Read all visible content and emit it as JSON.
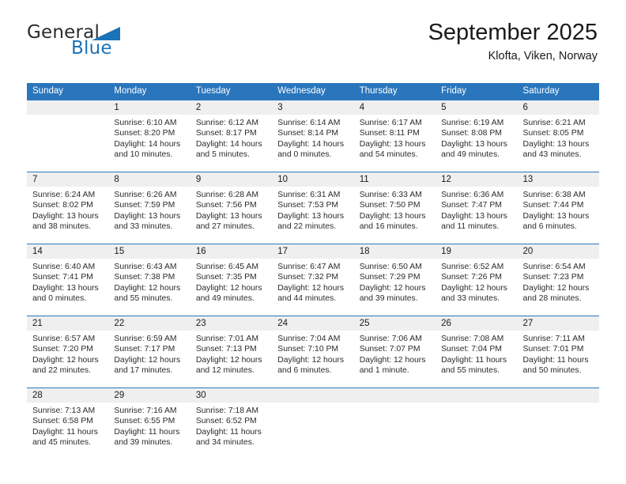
{
  "brand": {
    "name_part1": "General",
    "name_part2": "Blue",
    "triangle_icon": "triangle-icon",
    "accent_color": "#1b72b8"
  },
  "header": {
    "title": "September 2025",
    "subtitle": "Klofta, Viken, Norway"
  },
  "calendar": {
    "header_color": "#2a76bd",
    "daynum_band_color": "#efefef",
    "weekday_headers": [
      "Sunday",
      "Monday",
      "Tuesday",
      "Wednesday",
      "Thursday",
      "Friday",
      "Saturday"
    ],
    "weeks": [
      [
        {
          "day": "",
          "sunrise": "",
          "sunset": "",
          "daylight": ""
        },
        {
          "day": "1",
          "sunrise": "Sunrise: 6:10 AM",
          "sunset": "Sunset: 8:20 PM",
          "daylight": "Daylight: 14 hours and 10 minutes."
        },
        {
          "day": "2",
          "sunrise": "Sunrise: 6:12 AM",
          "sunset": "Sunset: 8:17 PM",
          "daylight": "Daylight: 14 hours and 5 minutes."
        },
        {
          "day": "3",
          "sunrise": "Sunrise: 6:14 AM",
          "sunset": "Sunset: 8:14 PM",
          "daylight": "Daylight: 14 hours and 0 minutes."
        },
        {
          "day": "4",
          "sunrise": "Sunrise: 6:17 AM",
          "sunset": "Sunset: 8:11 PM",
          "daylight": "Daylight: 13 hours and 54 minutes."
        },
        {
          "day": "5",
          "sunrise": "Sunrise: 6:19 AM",
          "sunset": "Sunset: 8:08 PM",
          "daylight": "Daylight: 13 hours and 49 minutes."
        },
        {
          "day": "6",
          "sunrise": "Sunrise: 6:21 AM",
          "sunset": "Sunset: 8:05 PM",
          "daylight": "Daylight: 13 hours and 43 minutes."
        }
      ],
      [
        {
          "day": "7",
          "sunrise": "Sunrise: 6:24 AM",
          "sunset": "Sunset: 8:02 PM",
          "daylight": "Daylight: 13 hours and 38 minutes."
        },
        {
          "day": "8",
          "sunrise": "Sunrise: 6:26 AM",
          "sunset": "Sunset: 7:59 PM",
          "daylight": "Daylight: 13 hours and 33 minutes."
        },
        {
          "day": "9",
          "sunrise": "Sunrise: 6:28 AM",
          "sunset": "Sunset: 7:56 PM",
          "daylight": "Daylight: 13 hours and 27 minutes."
        },
        {
          "day": "10",
          "sunrise": "Sunrise: 6:31 AM",
          "sunset": "Sunset: 7:53 PM",
          "daylight": "Daylight: 13 hours and 22 minutes."
        },
        {
          "day": "11",
          "sunrise": "Sunrise: 6:33 AM",
          "sunset": "Sunset: 7:50 PM",
          "daylight": "Daylight: 13 hours and 16 minutes."
        },
        {
          "day": "12",
          "sunrise": "Sunrise: 6:36 AM",
          "sunset": "Sunset: 7:47 PM",
          "daylight": "Daylight: 13 hours and 11 minutes."
        },
        {
          "day": "13",
          "sunrise": "Sunrise: 6:38 AM",
          "sunset": "Sunset: 7:44 PM",
          "daylight": "Daylight: 13 hours and 6 minutes."
        }
      ],
      [
        {
          "day": "14",
          "sunrise": "Sunrise: 6:40 AM",
          "sunset": "Sunset: 7:41 PM",
          "daylight": "Daylight: 13 hours and 0 minutes."
        },
        {
          "day": "15",
          "sunrise": "Sunrise: 6:43 AM",
          "sunset": "Sunset: 7:38 PM",
          "daylight": "Daylight: 12 hours and 55 minutes."
        },
        {
          "day": "16",
          "sunrise": "Sunrise: 6:45 AM",
          "sunset": "Sunset: 7:35 PM",
          "daylight": "Daylight: 12 hours and 49 minutes."
        },
        {
          "day": "17",
          "sunrise": "Sunrise: 6:47 AM",
          "sunset": "Sunset: 7:32 PM",
          "daylight": "Daylight: 12 hours and 44 minutes."
        },
        {
          "day": "18",
          "sunrise": "Sunrise: 6:50 AM",
          "sunset": "Sunset: 7:29 PM",
          "daylight": "Daylight: 12 hours and 39 minutes."
        },
        {
          "day": "19",
          "sunrise": "Sunrise: 6:52 AM",
          "sunset": "Sunset: 7:26 PM",
          "daylight": "Daylight: 12 hours and 33 minutes."
        },
        {
          "day": "20",
          "sunrise": "Sunrise: 6:54 AM",
          "sunset": "Sunset: 7:23 PM",
          "daylight": "Daylight: 12 hours and 28 minutes."
        }
      ],
      [
        {
          "day": "21",
          "sunrise": "Sunrise: 6:57 AM",
          "sunset": "Sunset: 7:20 PM",
          "daylight": "Daylight: 12 hours and 22 minutes."
        },
        {
          "day": "22",
          "sunrise": "Sunrise: 6:59 AM",
          "sunset": "Sunset: 7:17 PM",
          "daylight": "Daylight: 12 hours and 17 minutes."
        },
        {
          "day": "23",
          "sunrise": "Sunrise: 7:01 AM",
          "sunset": "Sunset: 7:13 PM",
          "daylight": "Daylight: 12 hours and 12 minutes."
        },
        {
          "day": "24",
          "sunrise": "Sunrise: 7:04 AM",
          "sunset": "Sunset: 7:10 PM",
          "daylight": "Daylight: 12 hours and 6 minutes."
        },
        {
          "day": "25",
          "sunrise": "Sunrise: 7:06 AM",
          "sunset": "Sunset: 7:07 PM",
          "daylight": "Daylight: 12 hours and 1 minute."
        },
        {
          "day": "26",
          "sunrise": "Sunrise: 7:08 AM",
          "sunset": "Sunset: 7:04 PM",
          "daylight": "Daylight: 11 hours and 55 minutes."
        },
        {
          "day": "27",
          "sunrise": "Sunrise: 7:11 AM",
          "sunset": "Sunset: 7:01 PM",
          "daylight": "Daylight: 11 hours and 50 minutes."
        }
      ],
      [
        {
          "day": "28",
          "sunrise": "Sunrise: 7:13 AM",
          "sunset": "Sunset: 6:58 PM",
          "daylight": "Daylight: 11 hours and 45 minutes."
        },
        {
          "day": "29",
          "sunrise": "Sunrise: 7:16 AM",
          "sunset": "Sunset: 6:55 PM",
          "daylight": "Daylight: 11 hours and 39 minutes."
        },
        {
          "day": "30",
          "sunrise": "Sunrise: 7:18 AM",
          "sunset": "Sunset: 6:52 PM",
          "daylight": "Daylight: 11 hours and 34 minutes."
        },
        {
          "day": "",
          "sunrise": "",
          "sunset": "",
          "daylight": ""
        },
        {
          "day": "",
          "sunrise": "",
          "sunset": "",
          "daylight": ""
        },
        {
          "day": "",
          "sunrise": "",
          "sunset": "",
          "daylight": ""
        },
        {
          "day": "",
          "sunrise": "",
          "sunset": "",
          "daylight": ""
        }
      ]
    ]
  }
}
